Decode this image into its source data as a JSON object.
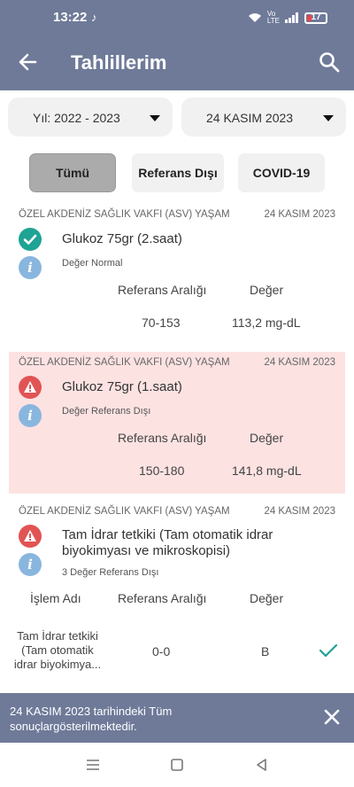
{
  "status_bar": {
    "time": "13:22",
    "app_icon": "tiktok-icon",
    "battery": "17"
  },
  "header": {
    "title": "Tahlillerim",
    "back_icon": "arrow-left-icon",
    "search_icon": "search-icon"
  },
  "filters": {
    "year": "Yıl: 2022 - 2023",
    "date": "24 KASIM 2023"
  },
  "tabs": [
    {
      "label": "Tümü",
      "active": true
    },
    {
      "label": "Referans Dışı",
      "active": false
    },
    {
      "label": "COVID-19",
      "active": false
    }
  ],
  "results": [
    {
      "institution": "ÖZEL AKDENİZ SAĞLIK VAKFI (ASV) YAŞAM",
      "date": "24 KASIM 2023",
      "name": "Glukoz 75gr (2.saat)",
      "status": "Değer Normal",
      "status_icon": "check-circle-icon",
      "ref_header": "Referans Aralığı",
      "value_header": "Değer",
      "ref_range": "70-153",
      "value": "113,2 mg-dL"
    },
    {
      "institution": "ÖZEL AKDENİZ SAĞLIK VAKFI (ASV) YAŞAM",
      "date": "24 KASIM 2023",
      "name": "Glukoz 75gr (1.saat)",
      "status": "Değer Referans Dışı",
      "status_icon": "warning-icon",
      "ref_header": "Referans Aralığı",
      "value_header": "Değer",
      "ref_range": "150-180",
      "value": "141,8 mg-dL",
      "highlight_color": "#fde2e2"
    },
    {
      "institution": "ÖZEL AKDENİZ SAĞLIK VAKFI (ASV) YAŞAM",
      "date": "24 KASIM 2023",
      "name_line1": "Tam İdrar tetkiki (Tam otomatik idrar",
      "name_line2": "biyokimyası ve mikroskopisi)",
      "status": "3 Değer Referans Dışı",
      "status_icon": "warning-icon",
      "col_name": "İşlem Adı",
      "ref_header": "Referans Aralığı",
      "value_header": "Değer",
      "sub_name_line1": "Tam İdrar tetkiki",
      "sub_name_line2": "(Tam otomatik",
      "sub_name_line3": "idrar biyokimya...",
      "sub_ref": "0-0",
      "sub_value": "B"
    }
  ],
  "toast": {
    "message": "24 KASIM 2023 tarihindeki Tüm sonuçlargösterilmektedir."
  },
  "colors": {
    "primary": "#6f7a99",
    "ok": "#1fa394",
    "bad": "#e15454",
    "info": "#89b6de"
  }
}
